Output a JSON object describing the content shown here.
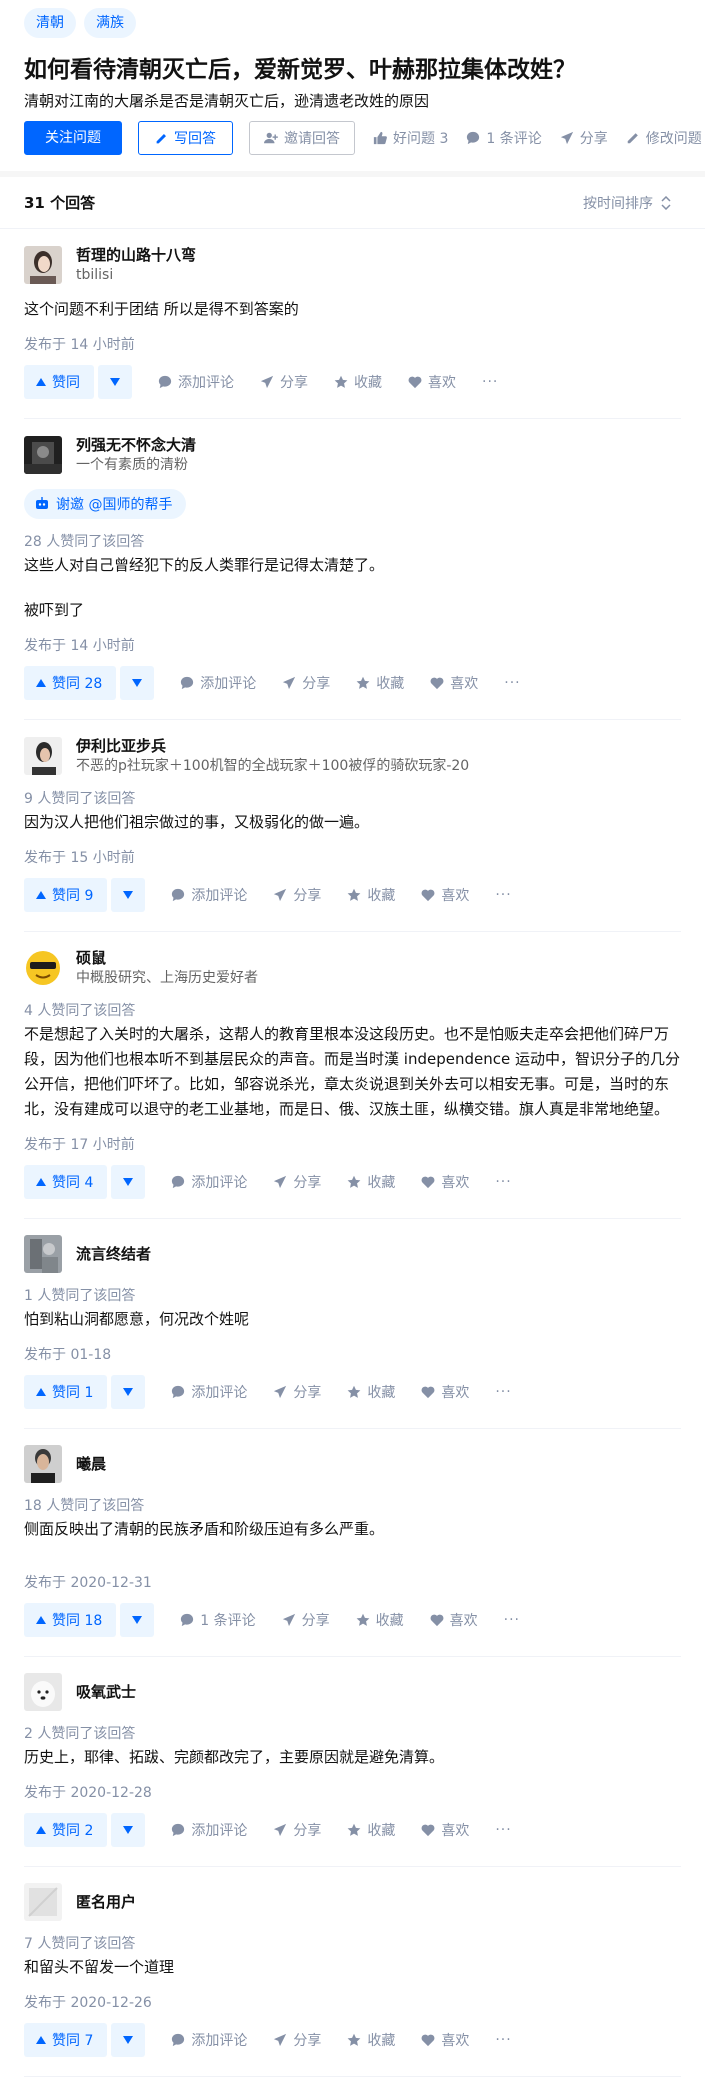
{
  "question": {
    "topics": [
      "清朝",
      "满族"
    ],
    "title": "如何看待清朝灭亡后，爱新觉罗、叶赫那拉集体改姓？",
    "description": "清朝对江南的大屠杀是否是清朝灭亡后，逊清遗老改姓的原因",
    "follow_label": "关注问题",
    "write_label": "写回答",
    "invite_label": "邀请回答",
    "good_question_label": "好问题 3",
    "comments_label": "1 条评论",
    "share_label": "分享",
    "edit_label": "修改问题"
  },
  "answers_header": {
    "count_label": "31 个回答",
    "sort_label": "按时间排序"
  },
  "action_labels": {
    "add_comment": "添加评论",
    "share": "分享",
    "collect": "收藏",
    "like": "喜欢",
    "more": "···"
  },
  "answers": [
    {
      "author": "哲理的山路十八弯",
      "bio": "tbilisi",
      "vote_meta": "",
      "content": [
        "这个问题不利于团结 所以是得不到答案的"
      ],
      "time": "发布于 14 小时前",
      "vote_label": "赞同",
      "comment_label": "添加评论",
      "avatar": "avatar-girl"
    },
    {
      "author": "列强无不怀念大清",
      "bio": "一个有素质的清粉",
      "invite": "谢邀 @国师的帮手",
      "vote_meta": "28 人赞同了该回答",
      "content": [
        "这些人对自己曾经犯下的反人类罪行是记得太清楚了。",
        "被吓到了"
      ],
      "time": "发布于 14 小时前",
      "vote_label": "赞同 28",
      "comment_label": "添加评论",
      "avatar": "avatar-dark"
    },
    {
      "author": "伊利比亚步兵",
      "bio": "不恶的p社玩家＋100机智的全战玩家＋100被俘的骑砍玩家-20",
      "vote_meta": "9 人赞同了该回答",
      "content": [
        "因为汉人把他们祖宗做过的事，又极弱化的做一遍。"
      ],
      "time": "发布于 15 小时前",
      "vote_label": "赞同 9",
      "comment_label": "添加评论",
      "avatar": "avatar-man"
    },
    {
      "author": "硕鼠",
      "bio": "中概股研究、上海历史爱好者",
      "vote_meta": "4 人赞同了该回答",
      "content": [
        "不是想起了入关时的大屠杀，这帮人的教育里根本没这段历史。也不是怕贩夫走卒会把他们碎尸万段，因为他们也根本听不到基层民众的声音。而是当时漢 independence 运动中，智识分子的几分公开信，把他们吓坏了。比如，邹容说杀光，章太炎说退到关外去可以相安无事。可是，当时的东北，没有建成可以退守的老工业基地，而是日、俄、汉族土匪，纵横交错。旗人真是非常地绝望。"
      ],
      "time": "发布于 17 小时前",
      "vote_label": "赞同 4",
      "comment_label": "添加评论",
      "avatar": "avatar-emoji"
    },
    {
      "author": "流言终结者",
      "bio": "",
      "vote_meta": "1 人赞同了该回答",
      "content": [
        "怕到粘山洞都愿意，何况改个姓呢"
      ],
      "time": "发布于 01-18",
      "vote_label": "赞同 1",
      "comment_label": "添加评论",
      "avatar": "avatar-grey"
    },
    {
      "author": "曦晨",
      "bio": "",
      "vote_meta": "18 人赞同了该回答",
      "content": [
        "侧面反映出了清朝的民族矛盾和阶级压迫有多么严重。"
      ],
      "time": "发布于 2020-12-31",
      "vote_label": "赞同 18",
      "comment_label": "1 条评论",
      "avatar": "avatar-portrait",
      "extra_gap": true
    },
    {
      "author": "吸氧武士",
      "bio": "",
      "vote_meta": "2 人赞同了该回答",
      "content": [
        "历史上，耶律、拓跋、完颜都改完了，主要原因就是避免清算。"
      ],
      "time": "发布于 2020-12-28",
      "vote_label": "赞同 2",
      "comment_label": "添加评论",
      "avatar": "avatar-dog"
    },
    {
      "author": "匿名用户",
      "bio": "",
      "vote_meta": "7 人赞同了该回答",
      "content": [
        "和留头不留发一个道理"
      ],
      "time": "发布于 2020-12-26",
      "vote_label": "赞同 7",
      "comment_label": "添加评论",
      "avatar": "avatar-anon"
    }
  ],
  "colors": {
    "brand": "#0066ff",
    "brand_light": "#ebf5ff",
    "muted": "#8590a6"
  }
}
